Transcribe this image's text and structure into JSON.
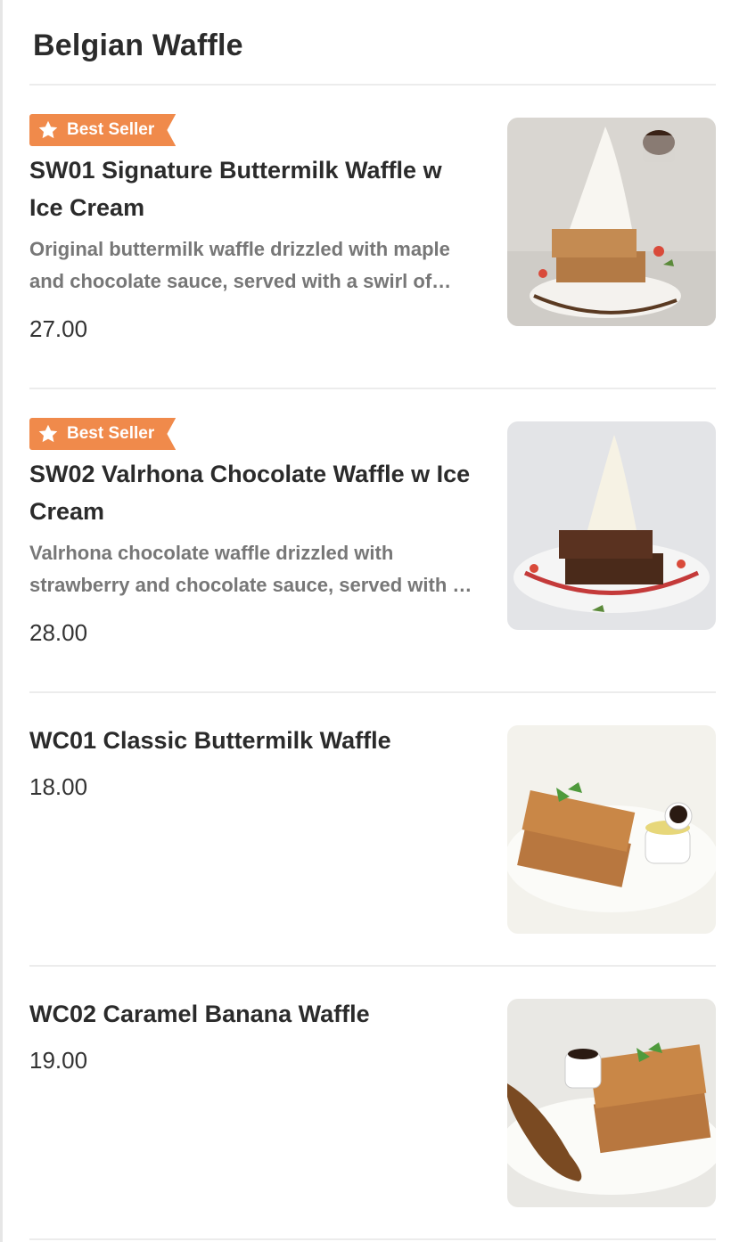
{
  "section": {
    "title": "Belgian Waffle"
  },
  "badge_icon": "star-icon",
  "colors": {
    "badge": "#f08a4b",
    "divider": "#ececec"
  },
  "items": [
    {
      "badge": "Best Seller",
      "title_line1": "SW01 Signature Buttermilk Waffle w",
      "title_line2": "Ice Cream",
      "description": "Original buttermilk waffle drizzled with maple and chocolate sauce, served with a swirl of…",
      "price": "27.00"
    },
    {
      "badge": "Best Seller",
      "title_line1": "SW02 Valrhona Chocolate Waffle w Ice",
      "title_line2": "Cream",
      "description": "Valrhona chocolate waffle drizzled with strawberry and chocolate sauce, served with …",
      "price": "28.00"
    },
    {
      "title_line1": "WC01 Classic Buttermilk Waffle",
      "price": "18.00"
    },
    {
      "title_line1": "WC02 Caramel Banana Waffle",
      "price": "19.00"
    }
  ]
}
